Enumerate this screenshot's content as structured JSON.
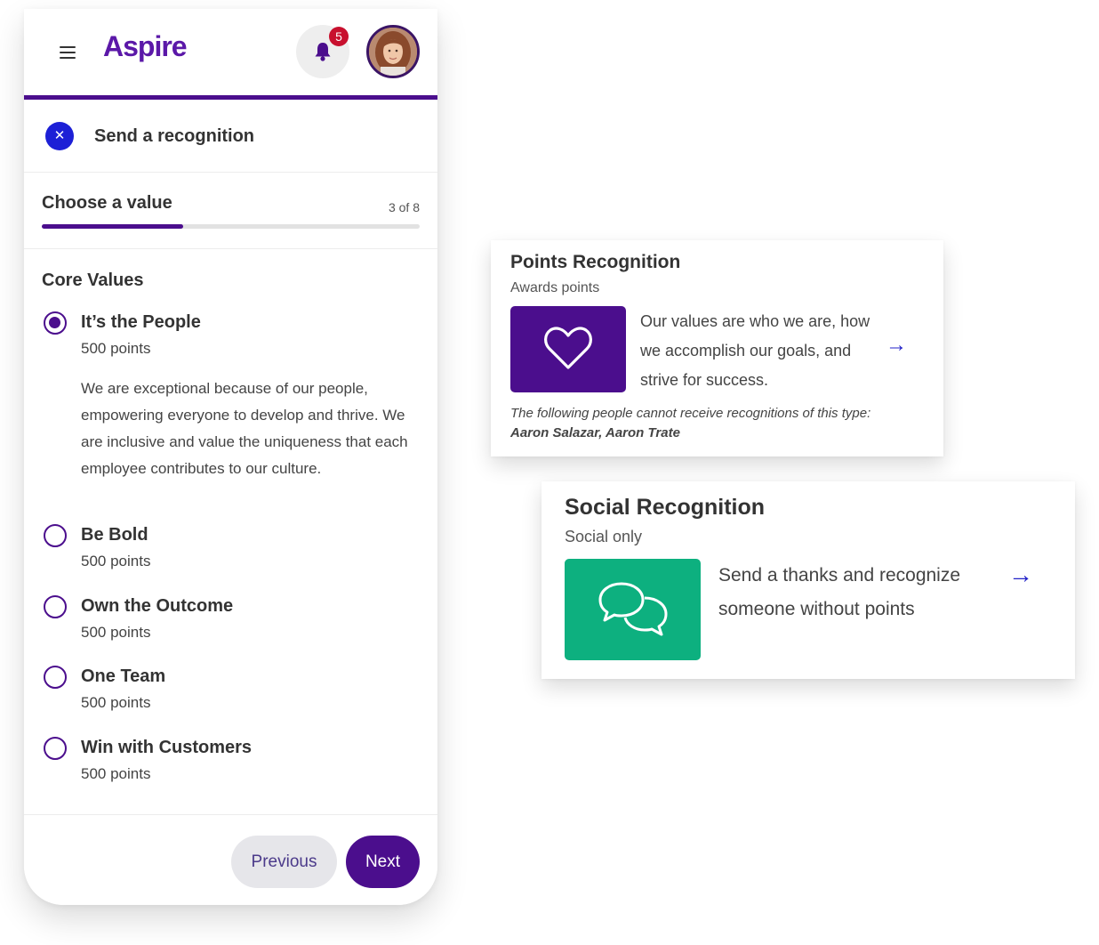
{
  "header": {
    "menu_icon": "hamburger-menu-icon",
    "logo": "Aspire",
    "notification_count": "5",
    "brand_color": "#4b0e8d"
  },
  "flow": {
    "title": "Send a recognition",
    "close_icon": "close-x-icon"
  },
  "step": {
    "title": "Choose a value",
    "counter": "3 of 8",
    "current": 3,
    "total": 8
  },
  "core_values": {
    "heading": "Core Values",
    "options": [
      {
        "title": "It’s the People",
        "points": "500 points",
        "selected": true,
        "description": "We are exceptional because of our people, empowering everyone to develop and thrive. We are inclusive and value the uniqueness that each employee contributes to our culture."
      },
      {
        "title": "Be Bold",
        "points": "500 points",
        "selected": false
      },
      {
        "title": "Own the Outcome",
        "points": "500 points",
        "selected": false
      },
      {
        "title": "One Team",
        "points": "500 points",
        "selected": false
      },
      {
        "title": "Win with Customers",
        "points": "500 points",
        "selected": false
      }
    ]
  },
  "footer": {
    "previous_label": "Previous",
    "next_label": "Next"
  },
  "points_card": {
    "title": "Points Recognition",
    "subtitle": "Awards points",
    "icon": "heart-icon",
    "icon_bg": "#4b0e8d",
    "description": "Our values are who we are, how we accomplish our goals, and strive for success.",
    "note_prefix": "The following people cannot receive recognitions of this type:",
    "note_names": "Aaron Salazar, Aaron Trate",
    "arrow": "→"
  },
  "social_card": {
    "title": "Social Recognition",
    "subtitle": "Social only",
    "icon": "chat-bubbles-icon",
    "icon_bg": "#0db07f",
    "description": "Send a thanks and recognize someone without points",
    "arrow": "→"
  }
}
